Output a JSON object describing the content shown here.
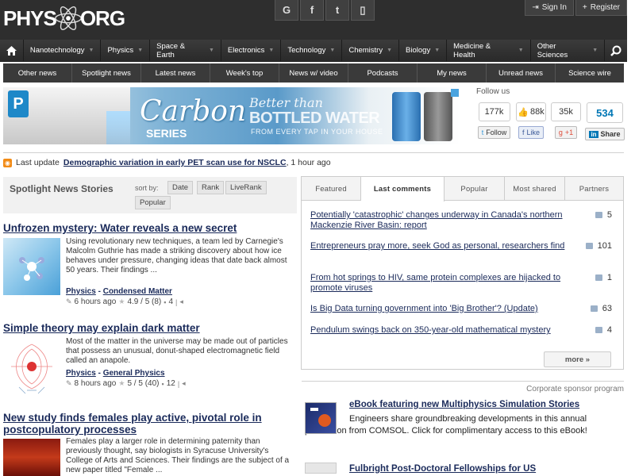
{
  "header": {
    "logo_left": "PHYS",
    "logo_right": "ORG",
    "social": [
      {
        "name": "google-plus",
        "glyph": "G"
      },
      {
        "name": "facebook",
        "glyph": "f"
      },
      {
        "name": "twitter",
        "glyph": "t"
      },
      {
        "name": "mobile",
        "glyph": "▯"
      }
    ],
    "sign_in": "Sign In",
    "register": "Register"
  },
  "main_nav": [
    "Nanotechnology",
    "Physics",
    "Space & Earth",
    "Electronics",
    "Technology",
    "Chemistry",
    "Biology",
    "Medicine & Health",
    "Other Sciences"
  ],
  "sub_nav": [
    "Other news",
    "Spotlight news",
    "Latest news",
    "Week's top",
    "News w/ video",
    "Podcasts",
    "My news",
    "Unread news",
    "Science wire"
  ],
  "banner": {
    "brand_letter": "P",
    "carbon": "Carbon",
    "series": "SERIES",
    "better": "Better than",
    "bottled": "BOTTLED WATER",
    "every": "FROM EVERY TAP IN YOUR HOUSE"
  },
  "follow": {
    "title": "Follow us",
    "items": [
      {
        "count": "177k",
        "button": "Follow"
      },
      {
        "count": "88k",
        "button": "Like"
      },
      {
        "count": "35k",
        "button": "+1"
      },
      {
        "count": "534",
        "button": "Share"
      }
    ]
  },
  "last_update": {
    "prefix": "Last update",
    "link": "Demographic variation in early PET scan use for NSCLC",
    "suffix": ", 1 hour ago"
  },
  "spotlight": {
    "title": "Spotlight News Stories",
    "sort_label": "sort by:",
    "sort_options": [
      "Date",
      "Rank",
      "LiveRank",
      "Popular"
    ]
  },
  "stories": [
    {
      "title": "Unfrozen mystery: Water reveals a new secret",
      "desc": "Using revolutionary new techniques, a team led by Carnegie's Malcolm Guthrie has made a striking discovery about how ice behaves under pressure, changing ideas that date back almost 50 years. Their findings ...",
      "cat1": "Physics",
      "cat2": "Condensed Matter",
      "time": "6 hours ago",
      "rating": "4.9 / 5 (8)",
      "comments": "4"
    },
    {
      "title": "Simple theory may explain dark matter",
      "desc": "Most of the matter in the universe may be made out of particles that possess an unusual, donut-shaped electromagnetic field called an anapole.",
      "cat1": "Physics",
      "cat2": "General Physics",
      "time": "8 hours ago",
      "rating": "5 / 5 (40)",
      "comments": "12"
    },
    {
      "title": "New study finds females play active, pivotal role in postcopulatory processes",
      "desc": "Females play a larger role in determining paternity than previously thought, say biologists in Syracuse University's College of Arts and Sciences. Their findings are the subject of a new paper titled \"Female ..."
    }
  ],
  "tabs": [
    "Featured",
    "Last comments",
    "Popular",
    "Most shared",
    "Partners"
  ],
  "comments": [
    {
      "text": "Potentially 'catastrophic' changes underway in Canada's northern Mackenzie River Basin: report",
      "count": "5"
    },
    {
      "text": "Entrepreneurs pray more, seek God as personal, researchers find",
      "count": "101"
    },
    {
      "text": "From hot springs to HIV, same protein complexes are hijacked to promote viruses",
      "count": "1"
    },
    {
      "text": "Is Big Data turning government into 'Big Brother'? (Update)",
      "count": "63"
    },
    {
      "text": "Pendulum swings back on 350-year-old mathematical mystery",
      "count": "4"
    }
  ],
  "more_label": "more »",
  "sponsor": {
    "label": "Corporate sponsor program",
    "items": [
      {
        "title": "eBook featuring new Multiphysics Simulation Stories",
        "desc": "Engineers share groundbreaking developments in this annual publication from COMSOL. Click for complimentary access to this eBook!"
      },
      {
        "title": "Fulbright Post-Doctoral Fellowships for US"
      }
    ]
  }
}
